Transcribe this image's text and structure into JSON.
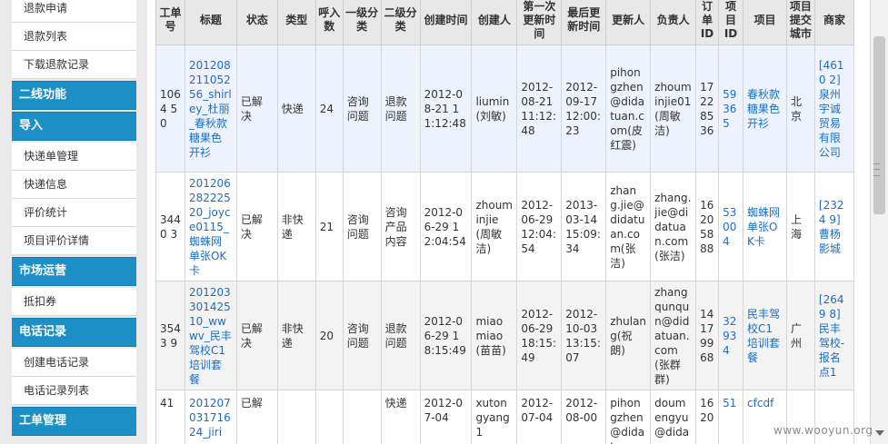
{
  "sidebar": {
    "items": [
      {
        "kind": "link",
        "label": "退款申请"
      },
      {
        "kind": "link",
        "label": "退款列表"
      },
      {
        "kind": "link",
        "label": "下载退款记录"
      },
      {
        "kind": "head",
        "label": "二线功能"
      },
      {
        "kind": "head",
        "label": "导入"
      },
      {
        "kind": "link",
        "label": "快递单管理"
      },
      {
        "kind": "link",
        "label": "快递信息"
      },
      {
        "kind": "link",
        "label": "评价统计"
      },
      {
        "kind": "link",
        "label": "项目评价详情"
      },
      {
        "kind": "head",
        "label": "市场运营"
      },
      {
        "kind": "link",
        "label": "抵扣券"
      },
      {
        "kind": "head",
        "label": "电话记录"
      },
      {
        "kind": "link",
        "label": "创建电话记录"
      },
      {
        "kind": "link",
        "label": "电话记录列表"
      },
      {
        "kind": "head",
        "label": "工单管理"
      }
    ]
  },
  "table": {
    "headers": [
      "工单号",
      "标题",
      "状态",
      "类型",
      "呼入数",
      "一级分类",
      "二级分类",
      "创建时间",
      "创建人",
      "第一次更新时间",
      "最后更新时间",
      "更新人",
      "负责人",
      "订单ID",
      "项目ID",
      "项目",
      "项目提交城市",
      "商家"
    ],
    "rows": [
      [
        "1064 50",
        "20120821105256_shirley_杜丽_春秋款糖果色开衫",
        "已解决",
        "快递",
        "24",
        "咨询问题",
        "退款问题",
        "2012-08-21 11:12:48",
        "liumin(刘敏)",
        "2012-08-21 11:12:48",
        "2012-09-17 12:00:23",
        "pihongzhen@didatuan.com(皮红震)",
        "zhouminjie01(周敏洁)",
        "17228536",
        "59365",
        "春秋款糖果色开衫",
        "北京",
        "[4610 2]泉州宇诚贸易有限公司"
      ],
      [
        "3440 3",
        "20120628222520_joyce0115_蜘蛛网单张OK卡",
        "已解决",
        "非快递",
        "21",
        "咨询问题",
        "咨询产品内容",
        "2012-06-29 12:04:54",
        "zhouminjie(周敏洁)",
        "2012-06-29 12:04:54",
        "2013-03-14 15:09:34",
        "zhang.jie@didatuan.com(张洁)",
        "zhang.jie@didatuan.com(张洁)",
        "16205888",
        "53004",
        "蜘蛛网单张OK卡",
        "上海",
        "[2324 9]曹杨影城"
      ],
      [
        "3543 9",
        "20120330142510_wwwv_民丰驾校C1培训套餐",
        "已解决",
        "非快递",
        "20",
        "咨询问题",
        "退款问题",
        "2012-06-29 18:15:49",
        "miaomiao(苗苗)",
        "2012-06-29 18:15:49",
        "2012-10-03 13:15:07",
        "zhulang(祝朗)",
        "zhangqunqun@didatuan.com(张群群)",
        "14179968",
        "32934",
        "民丰驾校C1培训套餐",
        "广州",
        "[2649 8]民丰驾校-报名点1"
      ],
      [
        "41",
        "20120703171624_jiri",
        "已解",
        "",
        "",
        "",
        "快递",
        "2012-07-04",
        "xutongyang1",
        "2012-07-04",
        "2012-08-00",
        "pihongzhen@didatuan",
        "doumengyu@dida",
        "1620",
        "51",
        "cfcdf",
        "",
        ""
      ]
    ]
  },
  "watermark": "www.wooyun.org",
  "colors": {
    "accent": "#1b8fc6",
    "link": "#1a6ec6",
    "row_highlight": "#eef2fc"
  }
}
